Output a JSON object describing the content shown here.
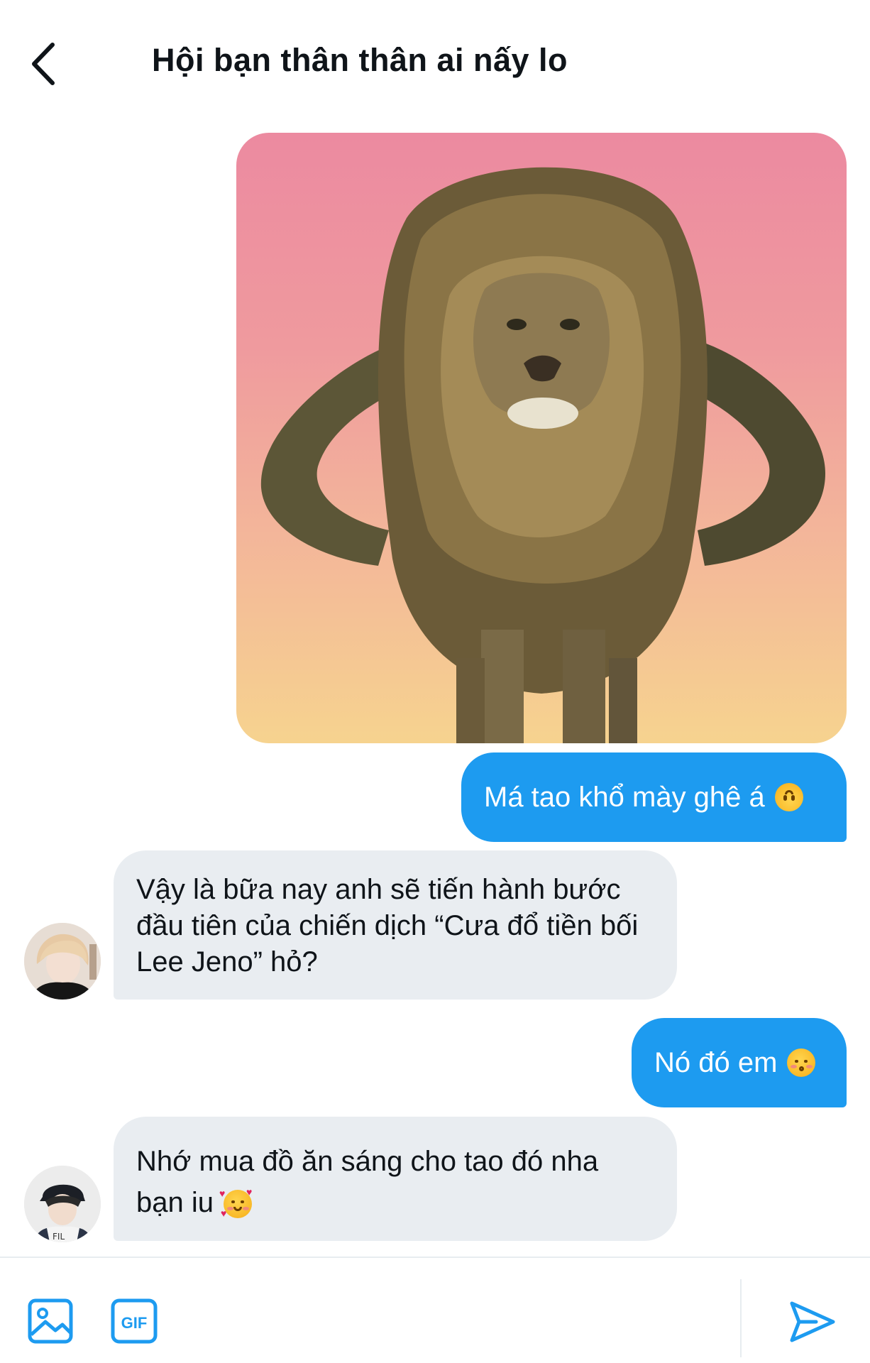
{
  "header": {
    "title": "Hội bạn thân thân ai nấy lo"
  },
  "messages": {
    "m1_image": {
      "alt": ""
    },
    "m2": {
      "text": "Má tao khổ mày ghê á",
      "emoji": "upside-down-face-icon"
    },
    "m3": {
      "text": "Vậy là bữa nay anh sẽ tiến hành bước đầu tiên của chiến dịch “Cưa đổ tiền bối Lee Jeno” hỏ?"
    },
    "m4": {
      "text": "Nó đó em",
      "emoji": "kissing-face-icon"
    },
    "m5": {
      "text": "Nhớ mua đồ ăn sáng cho tao đó nha bạn iu",
      "emoji": "smiling-face-with-hearts-icon"
    }
  },
  "composer": {
    "gif_label": "GIF"
  },
  "colors": {
    "accent": "#1d9bf0",
    "incoming_bubble": "#e9edf1",
    "text": "#0f1419"
  }
}
